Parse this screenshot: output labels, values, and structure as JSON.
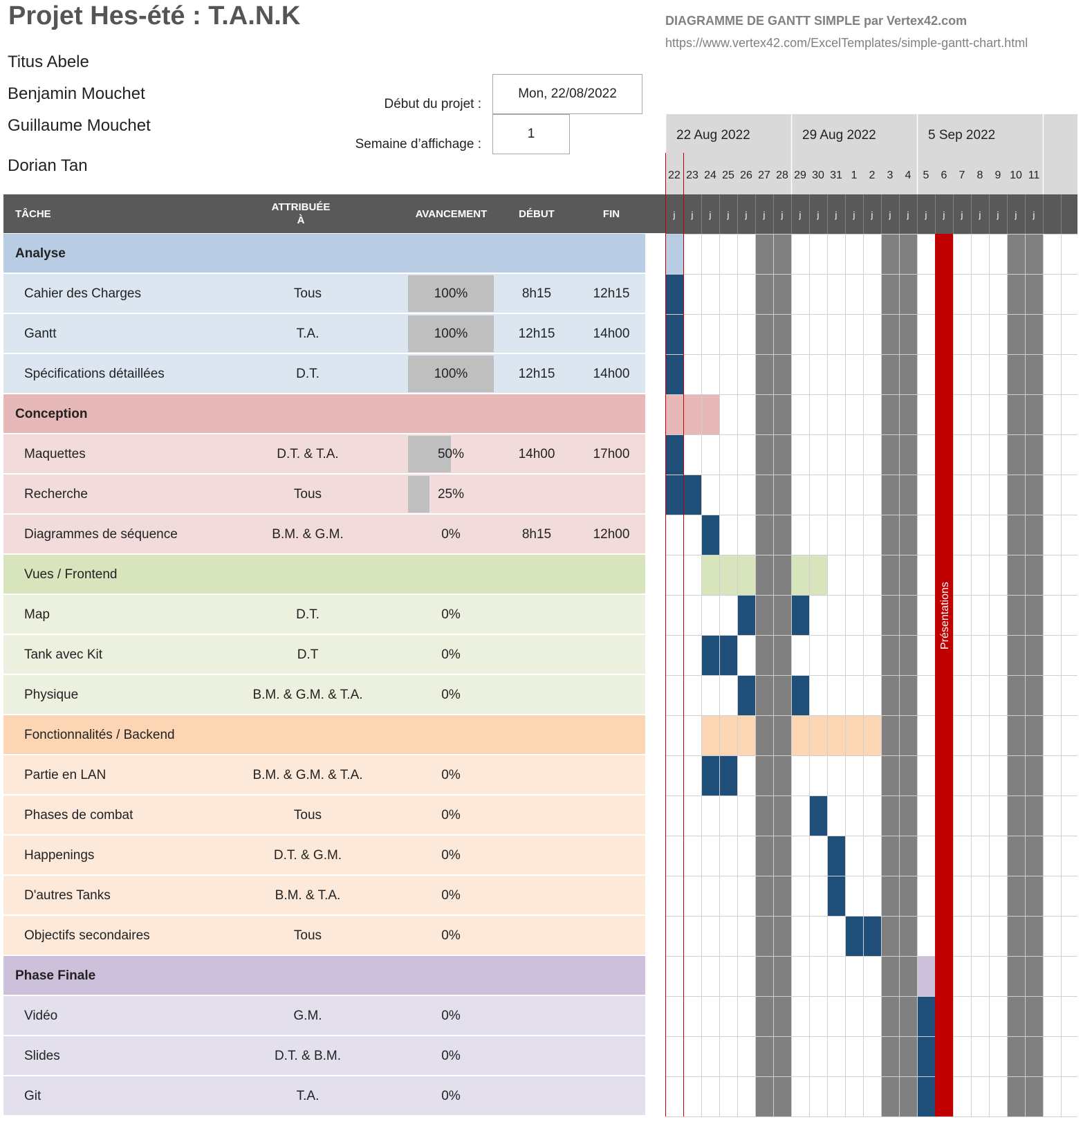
{
  "project": {
    "title": "Projet Hes-été : T.A.N.K",
    "members": [
      "Titus Abele",
      "Benjamin Mouchet",
      "Guillaume Mouchet",
      "Dorian Tan"
    ],
    "start_label": "Début du projet :",
    "start_value": "Mon, 22/08/2022",
    "week_label": "Semaine d’affichage :",
    "week_value": "1"
  },
  "template": {
    "title": "DIAGRAMME DE GANTT SIMPLE par Vertex42.com",
    "url": "https://www.vertex42.com/ExcelTemplates/simple-gantt-chart.html"
  },
  "table_headers": {
    "task": "TÂCHE",
    "assigned_line1": "ATTRIBUÉE",
    "assigned_line2": "À",
    "progress": "AVANCEMENT",
    "start": "DÉBUT",
    "end": "FIN"
  },
  "calendar": {
    "weeks": [
      "22 Aug 2022",
      "29 Aug 2022",
      "5 Sep 2022"
    ],
    "days": [
      "22",
      "23",
      "24",
      "25",
      "26",
      "27",
      "28",
      "29",
      "30",
      "31",
      "1",
      "2",
      "3",
      "4",
      "5",
      "6",
      "7",
      "8",
      "9",
      "10",
      "11"
    ],
    "day_letter": "j",
    "weekend_day_indices": [
      5,
      6,
      12,
      13,
      19,
      20
    ],
    "today_index": 0,
    "milestone": {
      "label": "Présentations",
      "day_index": 15,
      "color": "#c00000"
    }
  },
  "colors": {
    "bar": "#1f4e79",
    "weekend": "#808080",
    "header_bg": "#595959",
    "calendar_bg": "#d9d9d9",
    "today_line": "#c00000"
  },
  "phases": [
    {
      "name": "Analyse",
      "bold": true,
      "color_header": "#b8cce4",
      "color_row": "#dce6f1",
      "summary_span": [
        0,
        0
      ],
      "tasks": [
        {
          "name": "Cahier des Charges",
          "assigned": "Tous",
          "progress": "100%",
          "progress_value": 1.0,
          "start": "8h15",
          "end": "12h15",
          "days": [
            0
          ]
        },
        {
          "name": "Gantt",
          "assigned": "T.A.",
          "progress": "100%",
          "progress_value": 1.0,
          "start": "12h15",
          "end": "14h00",
          "days": [
            0
          ]
        },
        {
          "name": "Spécifications détaillées",
          "assigned": "D.T.",
          "progress": "100%",
          "progress_value": 1.0,
          "start": "12h15",
          "end": "14h00",
          "days": [
            0
          ]
        }
      ]
    },
    {
      "name": "Conception",
      "bold": true,
      "color_header": "#e6b8b7",
      "color_row": "#f2dcdb",
      "summary_span": [
        0,
        2
      ],
      "tasks": [
        {
          "name": "Maquettes",
          "assigned": "D.T. & T.A.",
          "progress": "50%",
          "progress_value": 0.5,
          "start": "14h00",
          "end": "17h00",
          "days": [
            0
          ]
        },
        {
          "name": "Recherche",
          "assigned": "Tous",
          "progress": "25%",
          "progress_value": 0.25,
          "start": "",
          "end": "",
          "days": [
            0,
            1
          ]
        },
        {
          "name": "Diagrammes de séquence",
          "assigned": "B.M. & G.M.",
          "progress": "0%",
          "progress_value": 0,
          "start": "8h15",
          "end": "12h00",
          "days": [
            2
          ]
        }
      ]
    },
    {
      "name": "Vues / Frontend",
      "bold": false,
      "color_header": "#d8e4bc",
      "color_row": "#ebf1de",
      "summary_span": [
        2,
        8
      ],
      "tasks": [
        {
          "name": "Map",
          "assigned": "D.T.",
          "progress": "0%",
          "progress_value": 0,
          "start": "",
          "end": "",
          "days": [
            4,
            7
          ]
        },
        {
          "name": "Tank avec Kit",
          "assigned": "D.T",
          "progress": "0%",
          "progress_value": 0,
          "start": "",
          "end": "",
          "days": [
            2,
            3
          ]
        },
        {
          "name": "Physique",
          "assigned": "B.M. & G.M. & T.A.",
          "progress": "0%",
          "progress_value": 0,
          "start": "",
          "end": "",
          "days": [
            4,
            7
          ]
        }
      ]
    },
    {
      "name": "Fonctionnalités / Backend",
      "bold": false,
      "color_header": "#fcd5b4",
      "color_row": "#fde9d9",
      "summary_span": [
        2,
        11
      ],
      "tasks": [
        {
          "name": "Partie en LAN",
          "assigned": "B.M. & G.M. & T.A.",
          "progress": "0%",
          "progress_value": 0,
          "start": "",
          "end": "",
          "days": [
            2,
            3
          ]
        },
        {
          "name": "Phases de combat",
          "assigned": "Tous",
          "progress": "0%",
          "progress_value": 0,
          "start": "",
          "end": "",
          "days": [
            8
          ]
        },
        {
          "name": "Happenings",
          "assigned": "D.T. & G.M.",
          "progress": "0%",
          "progress_value": 0,
          "start": "",
          "end": "",
          "days": [
            9
          ]
        },
        {
          "name": "D'autres Tanks",
          "assigned": "B.M. & T.A.",
          "progress": "0%",
          "progress_value": 0,
          "start": "",
          "end": "",
          "days": [
            9
          ]
        },
        {
          "name": "Objectifs secondaires",
          "assigned": "Tous",
          "progress": "0%",
          "progress_value": 0,
          "start": "",
          "end": "",
          "days": [
            10,
            11
          ]
        }
      ]
    },
    {
      "name": "Phase Finale",
      "bold": true,
      "color_header": "#ccc0da",
      "color_row": "#e4dfec",
      "summary_span": [
        14,
        14
      ],
      "tasks": [
        {
          "name": "Vidéo",
          "assigned": "G.M.",
          "progress": "0%",
          "progress_value": 0,
          "start": "",
          "end": "",
          "days": [
            14
          ]
        },
        {
          "name": "Slides",
          "assigned": "D.T. & B.M.",
          "progress": "0%",
          "progress_value": 0,
          "start": "",
          "end": "",
          "days": [
            14
          ]
        },
        {
          "name": "Git",
          "assigned": "T.A.",
          "progress": "0%",
          "progress_value": 0,
          "start": "",
          "end": "",
          "days": [
            14
          ]
        }
      ]
    }
  ]
}
